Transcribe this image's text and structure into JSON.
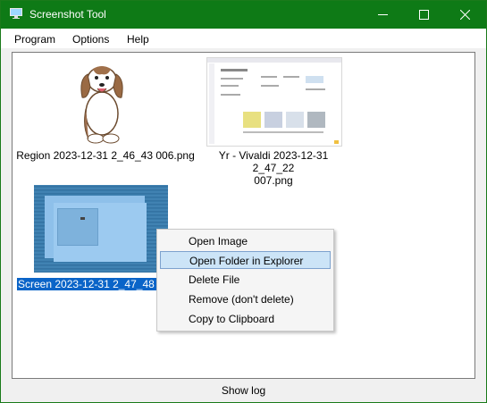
{
  "window": {
    "title": "Screenshot Tool",
    "icon": "monitor-icon",
    "controls": [
      "minimize-icon",
      "maximize-icon",
      "close-icon"
    ],
    "accent_color": "#0e7a16"
  },
  "menu": {
    "program": "Program",
    "options": "Options",
    "help": "Help"
  },
  "thumbnails": [
    {
      "caption_line1": "Region 2023-12-31 2_46_43 006.png",
      "caption_line2": ""
    },
    {
      "caption_line1": "Yr - Vivaldi 2023-12-31 2_47_22",
      "caption_line2": "007.png"
    },
    {
      "caption_line1": "Screen 2023-12-31 2_47_48 00",
      "selected": true
    }
  ],
  "context_menu": {
    "items": [
      "Open Image",
      "Open Folder in Explorer",
      "Delete File",
      "Remove (don't delete)",
      "Copy to Clipboard"
    ],
    "highlighted_index": 1
  },
  "footer": {
    "show_log": "Show log"
  }
}
